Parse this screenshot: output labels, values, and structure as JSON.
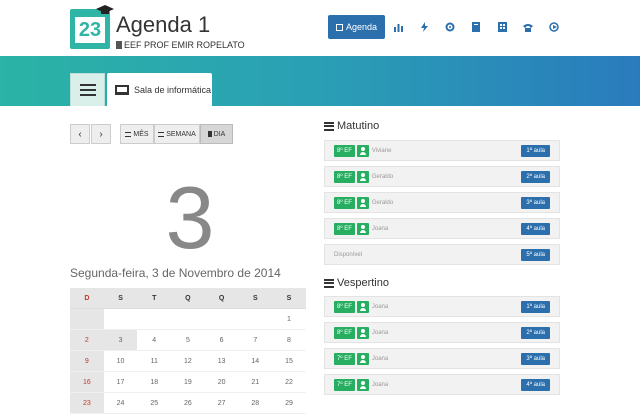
{
  "app": {
    "logo_number": "23",
    "title": "Agenda 1",
    "subtitle": "EEF PROF EMIR ROPELATO"
  },
  "nav": {
    "active_label": "Agenda",
    "icons": [
      "bar-chart-icon",
      "bolt-icon",
      "gear-icon",
      "book-icon",
      "building-icon",
      "phone-icon",
      "logout-icon"
    ]
  },
  "tabs": {
    "list_icon": "list-icon",
    "room_label": "Sala de informática"
  },
  "view": {
    "prev": "‹",
    "next": "›",
    "month": "MÊS",
    "week": "SEMANA",
    "day": "DIA",
    "active": "day"
  },
  "day": {
    "number": "3",
    "label": "Segunda-feira, 3 de Novembro de 2014"
  },
  "calendar": {
    "headers": [
      "D",
      "S",
      "T",
      "Q",
      "Q",
      "S",
      "S"
    ],
    "weeks": [
      [
        "",
        "",
        "",
        "",
        "",
        "",
        "1"
      ],
      [
        "2",
        "3",
        "4",
        "5",
        "6",
        "7",
        "8"
      ],
      [
        "9",
        "10",
        "11",
        "12",
        "13",
        "14",
        "15"
      ],
      [
        "16",
        "17",
        "18",
        "19",
        "20",
        "21",
        "22"
      ],
      [
        "23",
        "24",
        "25",
        "26",
        "27",
        "28",
        "29"
      ]
    ]
  },
  "matutino": {
    "title": "Matutino",
    "slots": [
      {
        "grade": "8º EF",
        "name": "Viviane",
        "aula": "1ª aula"
      },
      {
        "grade": "8º EF",
        "name": "Geraldo",
        "aula": "2ª aula"
      },
      {
        "grade": "8º EF",
        "name": "Geraldo",
        "aula": "3ª aula"
      },
      {
        "grade": "8º EF",
        "name": "Joana",
        "aula": "4ª aula"
      },
      {
        "free": "Disponível",
        "aula": "5ª aula"
      }
    ]
  },
  "vespertino": {
    "title": "Vespertino",
    "slots": [
      {
        "grade": "8º EF",
        "name": "Joana",
        "aula": "1ª aula"
      },
      {
        "grade": "8º EF",
        "name": "Joana",
        "aula": "2ª aula"
      },
      {
        "grade": "7º EF",
        "name": "Joana",
        "aula": "3ª aula"
      },
      {
        "grade": "7º EF",
        "name": "Joana",
        "aula": "4ª aula"
      }
    ]
  },
  "colors": {
    "primary": "#2c6fad",
    "teal": "#2bb3a6",
    "green": "#27ae60",
    "sunday": "#c0392b"
  }
}
